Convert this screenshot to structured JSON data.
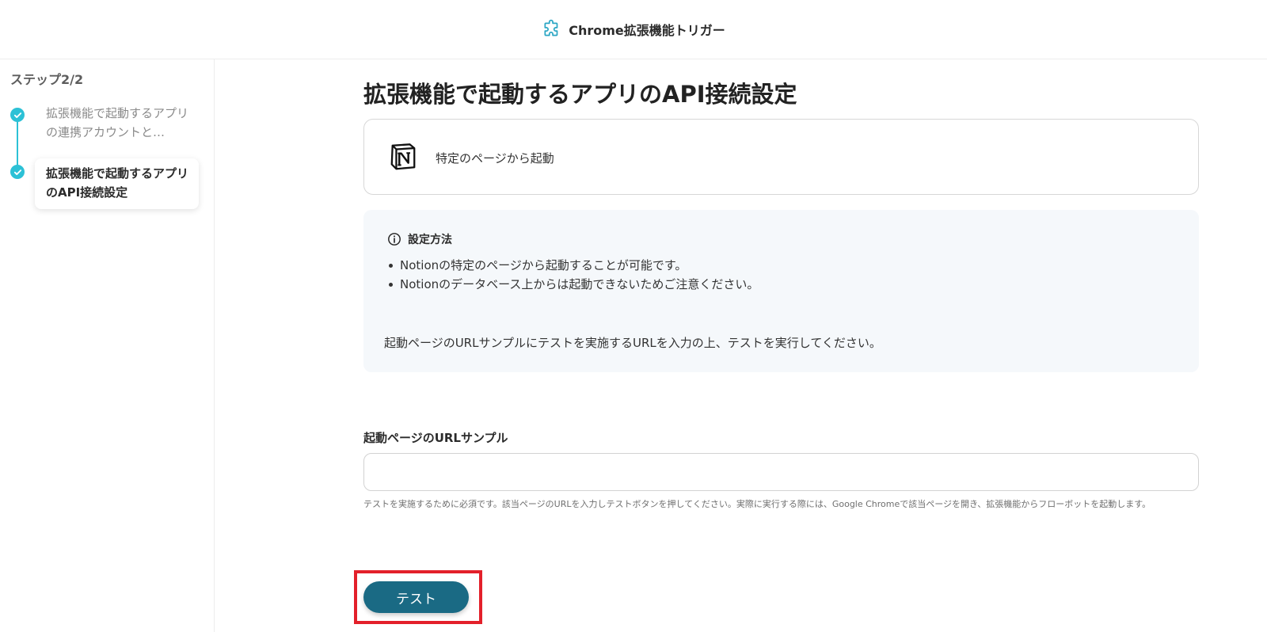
{
  "header": {
    "title": "Chrome拡張機能トリガー",
    "icon": "puzzle-icon"
  },
  "sidebar": {
    "step_counter": "ステップ2/2",
    "steps": [
      {
        "label": "拡張機能で起動するアプリの連携アカウントと…",
        "status": "completed"
      },
      {
        "label": "拡張機能で起動するアプリのAPI接続設定",
        "status": "current"
      }
    ],
    "accent_color": "#2cc1d6"
  },
  "main": {
    "title": "拡張機能で起動するアプリのAPI接続設定",
    "app_card": {
      "app_icon": "notion-logo",
      "trigger_label": "特定のページから起動"
    },
    "info_box": {
      "heading": "設定方法",
      "items": [
        "Notionの特定のページから起動することが可能です。",
        "Notionのデータベース上からは起動できないためご注意ください。"
      ],
      "note": "起動ページのURLサンプルにテストを実施するURLを入力の上、テストを実行してください。"
    },
    "url_field": {
      "label": "起動ページのURLサンプル",
      "value": "",
      "placeholder": "",
      "help": "テストを実施するために必須です。該当ページのURLを入力しテストボタンを押してください。実際に実行する際には、Google Chromeで該当ページを開き、拡張機能からフローボットを起動します。"
    },
    "test_button": {
      "label": "テスト",
      "color": "#1a6a84"
    },
    "highlight_color": "#e3202a"
  }
}
